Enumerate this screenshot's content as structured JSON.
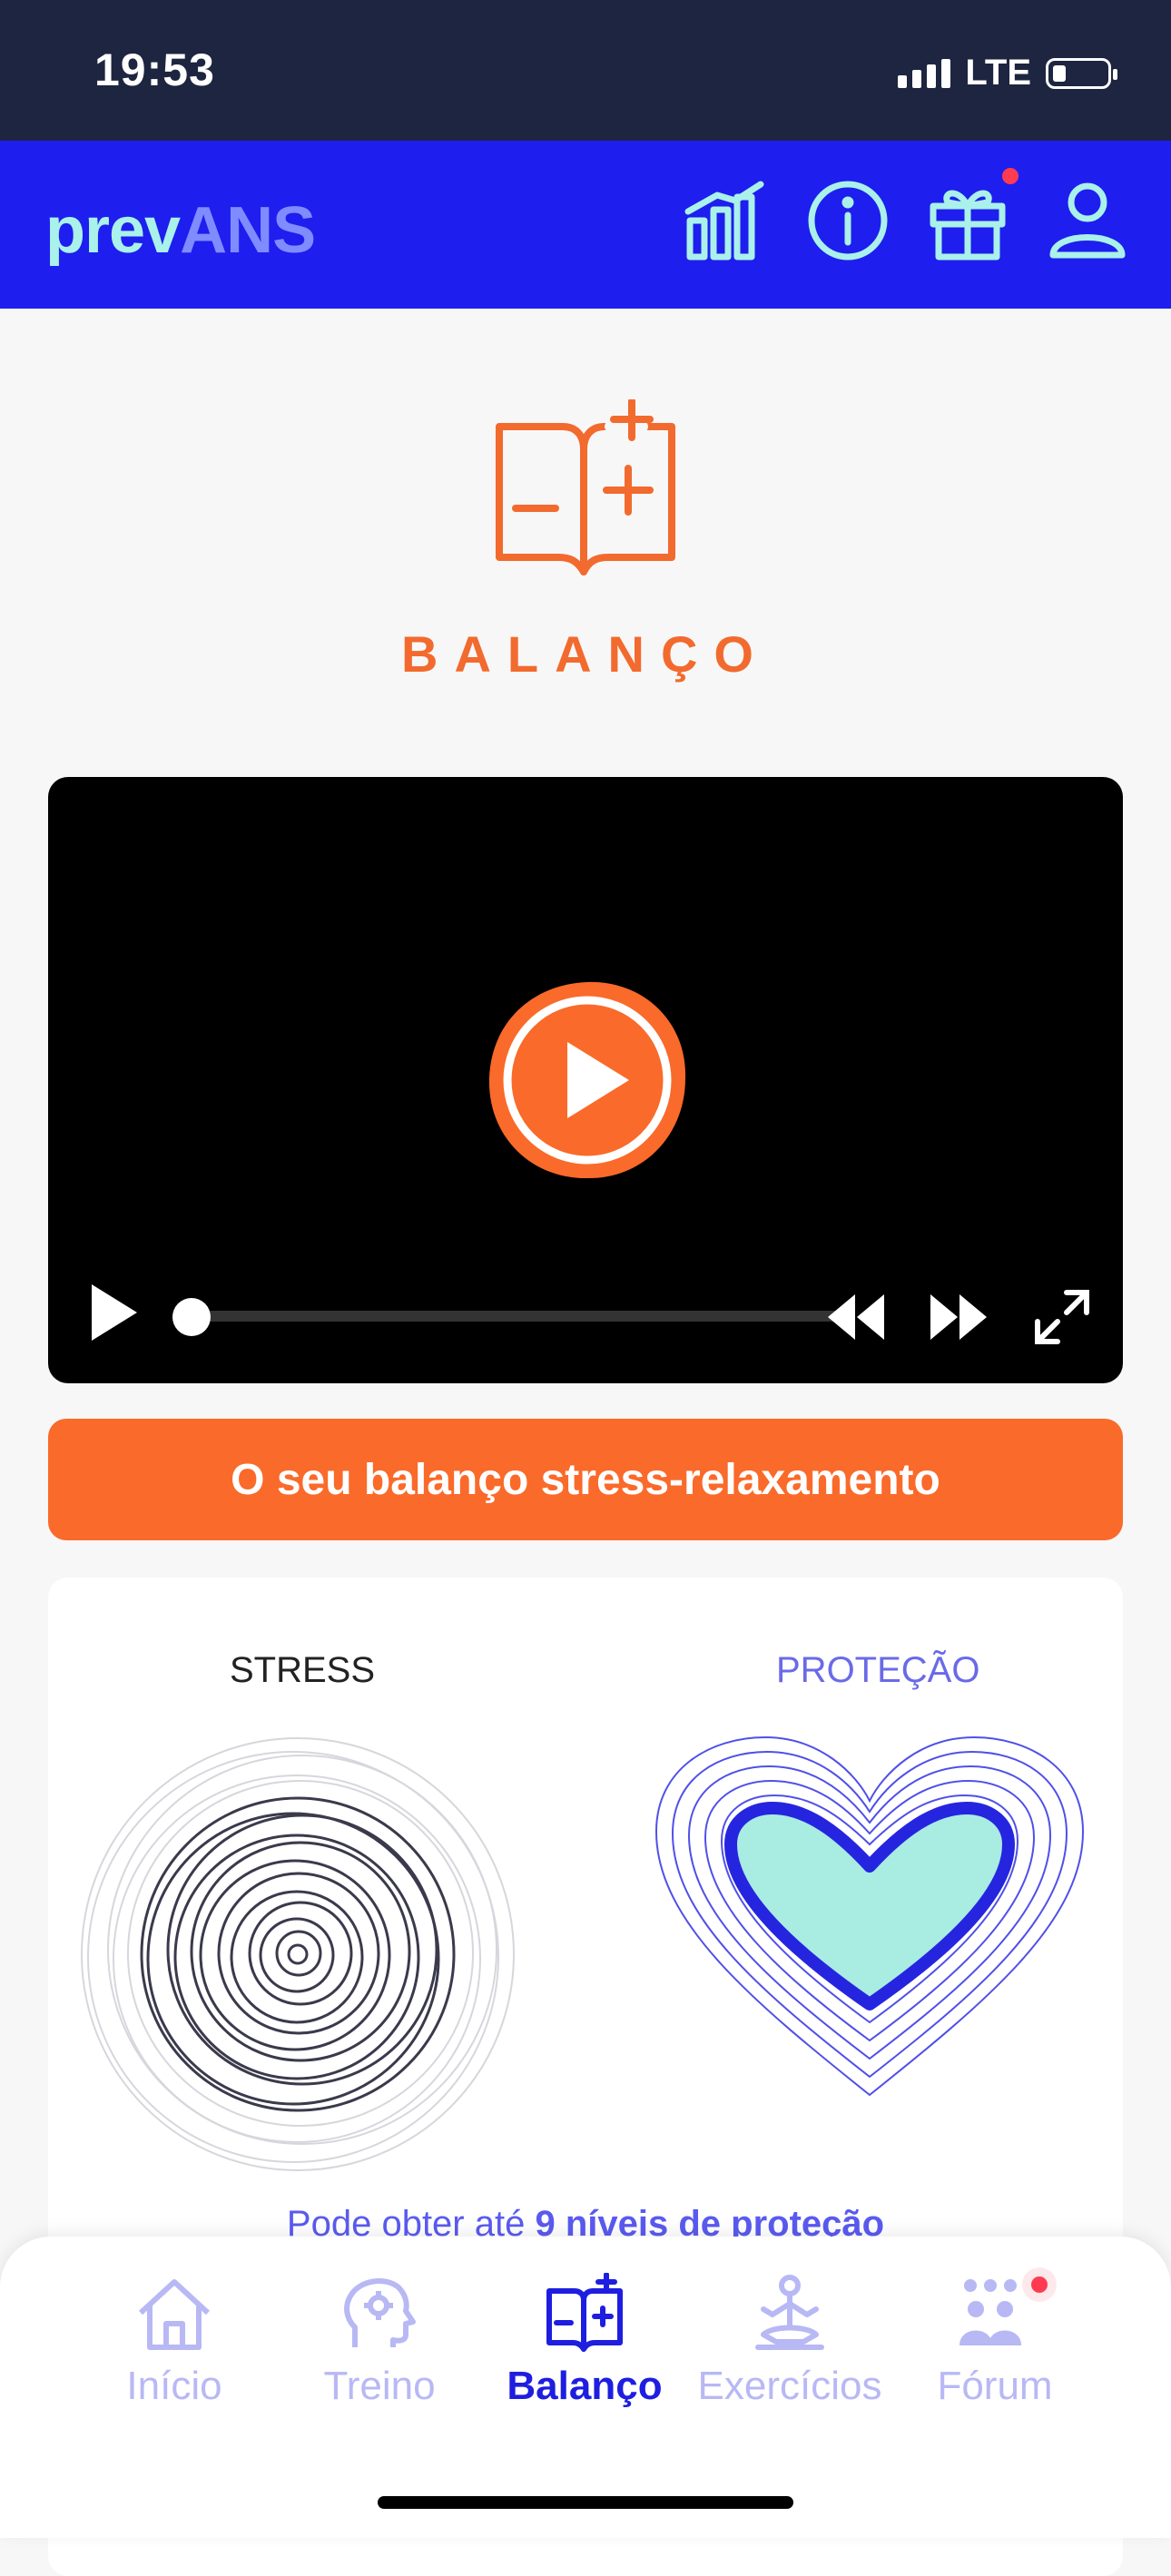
{
  "status_bar": {
    "time": "19:53",
    "network": "LTE"
  },
  "app_bar": {
    "logo_part1": "prev",
    "logo_part2": "ANS",
    "icons": [
      "chart-icon",
      "info-icon",
      "gift-icon",
      "profile-icon"
    ]
  },
  "section": {
    "title": "BALANÇO"
  },
  "video": {
    "progress": 0.0
  },
  "cta": {
    "label": "O seu balanço stress-relaxamento"
  },
  "card": {
    "stress_label": "STRESS",
    "protection_label": "PROTEÇÃO",
    "note_prefix": "Pode obter até ",
    "note_bold": "9 níveis de proteção"
  },
  "bottom_nav": {
    "items": [
      {
        "label": "Início",
        "icon": "home-icon",
        "active": false
      },
      {
        "label": "Treino",
        "icon": "brain-icon",
        "active": false
      },
      {
        "label": "Balanço",
        "icon": "balance-book-icon",
        "active": true
      },
      {
        "label": "Exercícios",
        "icon": "meditation-icon",
        "active": false
      },
      {
        "label": "Fórum",
        "icon": "forum-icon",
        "active": false
      }
    ]
  },
  "colors": {
    "accent_orange": "#fa6a2a",
    "brand_blue": "#1e1eef",
    "status_dark": "#1d2540",
    "protection_teal": "#a9ece2"
  }
}
